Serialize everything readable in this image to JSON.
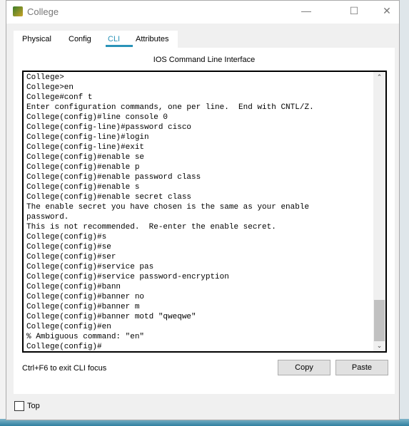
{
  "window": {
    "title": "College",
    "controls": [
      "minimize",
      "maximize",
      "close"
    ]
  },
  "tabs": [
    {
      "label": "Physical"
    },
    {
      "label": "Config"
    },
    {
      "label": "CLI",
      "active": true
    },
    {
      "label": "Attributes"
    }
  ],
  "panel_title": "IOS Command Line Interface",
  "terminal_lines": [
    "College>",
    "College>en",
    "College#conf t",
    "Enter configuration commands, one per line.  End with CNTL/Z.",
    "College(config)#line console 0",
    "College(config-line)#password cisco",
    "College(config-line)#login",
    "College(config-line)#exit",
    "College(config)#enable se",
    "College(config)#enable p",
    "College(config)#enable password class",
    "College(config)#enable s",
    "College(config)#enable secret class",
    "The enable secret you have chosen is the same as your enable",
    "password.",
    "This is not recommended.  Re-enter the enable secret.",
    "College(config)#s",
    "College(config)#se",
    "College(config)#ser",
    "College(config)#service pas",
    "College(config)#service password-encryption",
    "College(config)#bann",
    "College(config)#banner no",
    "College(config)#banner m",
    "College(config)#banner motd \"qweqwe\"",
    "College(config)#en",
    "% Ambiguous command: \"en\"",
    "College(config)#"
  ],
  "hint": "Ctrl+F6 to exit CLI focus",
  "buttons": {
    "copy": "Copy",
    "paste": "Paste"
  },
  "top_checkbox": {
    "label": "Top",
    "checked": false
  },
  "accent": "#2a93b8"
}
